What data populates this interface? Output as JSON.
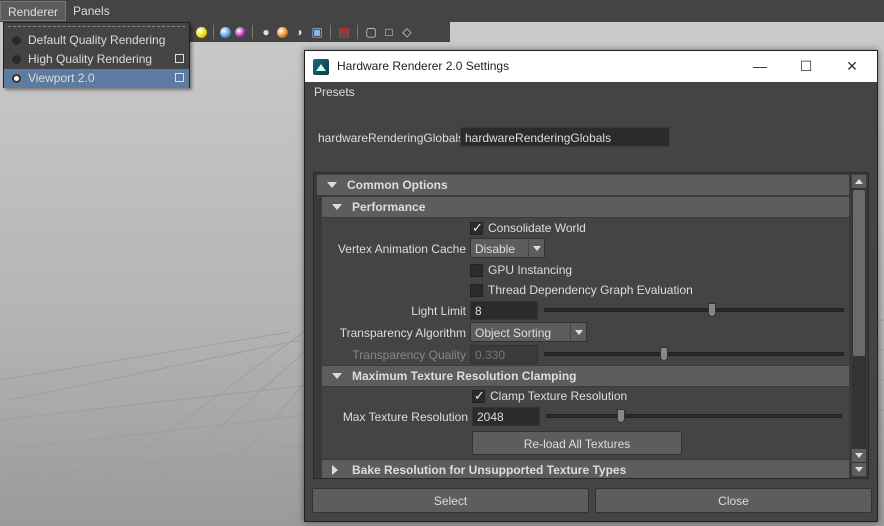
{
  "menubar": {
    "items": [
      {
        "label": "Renderer"
      },
      {
        "label": "Panels"
      }
    ]
  },
  "toolbar": {
    "icons": [
      "yellow-sphere-icon",
      "blue-sphere-icon",
      "purple-sphere-icon",
      "light-icon",
      "orange-light-icon",
      "shadow-icon",
      "texture-icon",
      "select-icon",
      "cube-icon",
      "isolate-icon",
      "graph-icon"
    ],
    "colors": {
      "yellow": "#e8e000",
      "blue": "#5aa0e0",
      "purple": "#a030a0"
    }
  },
  "renderer_menu": {
    "items": [
      {
        "label": "Default Quality Rendering",
        "selected": false,
        "option_box": false
      },
      {
        "label": "High Quality Rendering",
        "selected": false,
        "option_box": true
      },
      {
        "label": "Viewport 2.0",
        "selected": true,
        "option_box": true
      }
    ],
    "highlight_color": "#5d7aa1"
  },
  "window": {
    "title": "Hardware Renderer 2.0 Settings",
    "controls": {
      "minimize": "—",
      "maximize": "☐",
      "close": "✕"
    },
    "presets_label": "Presets",
    "globals_label": "hardwareRenderingGlobals:",
    "globals_value": "hardwareRenderingGlobals",
    "sections": {
      "common": "Common Options",
      "performance": "Performance",
      "max_texture": "Maximum Texture Resolution Clamping",
      "bake": "Bake Resolution for Unsupported Texture Types"
    },
    "performance": {
      "consolidate_world": {
        "label": "Consolidate World",
        "checked": true
      },
      "vertex_cache": {
        "label": "Vertex Animation Cache",
        "value": "Disable"
      },
      "gpu_instancing": {
        "label": "GPU Instancing",
        "checked": false
      },
      "thread_dep": {
        "label": "Thread Dependency Graph Evaluation",
        "checked": false
      },
      "light_limit": {
        "label": "Light Limit",
        "value": "8",
        "slider_fraction": 0.56
      },
      "transparency_algorithm": {
        "label": "Transparency Algorithm",
        "value": "Object Sorting"
      },
      "transparency_quality": {
        "label": "Transparency Quality",
        "value": "0.330",
        "slider_fraction": 0.4,
        "enabled": false
      }
    },
    "max_texture": {
      "clamp": {
        "label": "Clamp Texture Resolution",
        "checked": true
      },
      "max_res": {
        "label": "Max Texture Resolution",
        "value": "2048",
        "slider_fraction": 0.25
      },
      "reload_button": "Re-load All Textures"
    },
    "buttons": {
      "select": "Select",
      "close": "Close"
    }
  }
}
